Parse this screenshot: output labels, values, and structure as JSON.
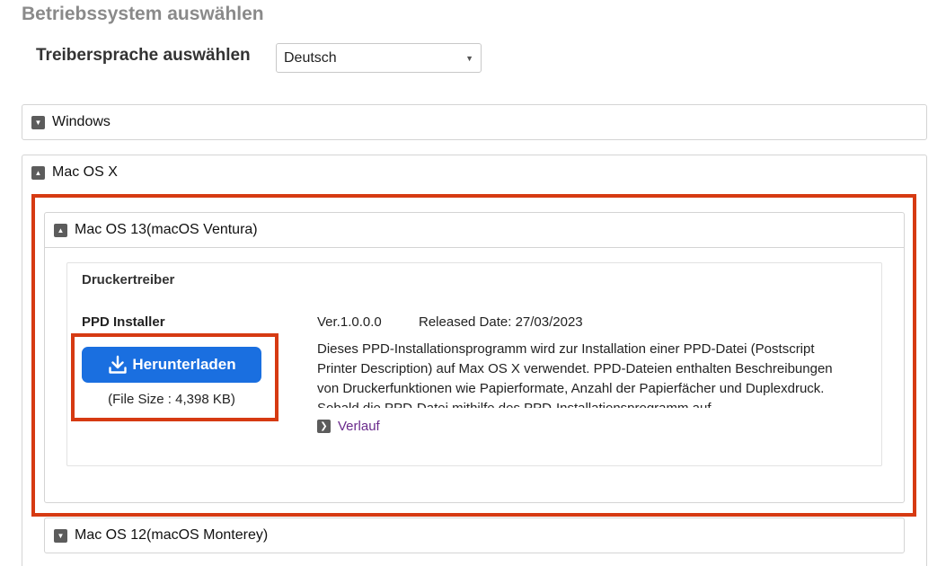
{
  "page": {
    "title": "Betriebssystem auswählen"
  },
  "language": {
    "label": "Treibersprache auswählen",
    "selected": "Deutsch"
  },
  "os_sections": {
    "windows": {
      "label": "Windows",
      "toggle": "▼"
    },
    "mac": {
      "label": "Mac OS X",
      "toggle": "▲"
    }
  },
  "mac_versions": {
    "ventura": {
      "label": "Mac OS 13(macOS Ventura)",
      "toggle": "▲"
    },
    "monterey": {
      "label": "Mac OS 12(macOS Monterey)",
      "toggle": "▼"
    }
  },
  "driver": {
    "category": "Druckertreiber",
    "name": "PPD Installer",
    "download_label": "Herunterladen",
    "file_size": "(File Size : 4,398 KB)",
    "version": "Ver.1.0.0.0",
    "released": "Released Date: 27/03/2023",
    "description": "Dieses PPD-Installationsprogramm wird zur Installation einer PPD-Datei (Postscript Printer Description) auf Max OS X verwendet. PPD-Dateien enthalten Beschreibungen von Druckerfunktionen wie Papierformate, Anzahl der Papierfächer und Duplexdruck. Sobald die PPD-Datei mithilfe des PPD-Installationsprogramm auf",
    "history_label": "Verlauf",
    "history_icon": "chevron-right-icon"
  },
  "colors": {
    "highlight": "#d63a12",
    "button": "#1a6fe0",
    "link": "#6a2a8c"
  }
}
